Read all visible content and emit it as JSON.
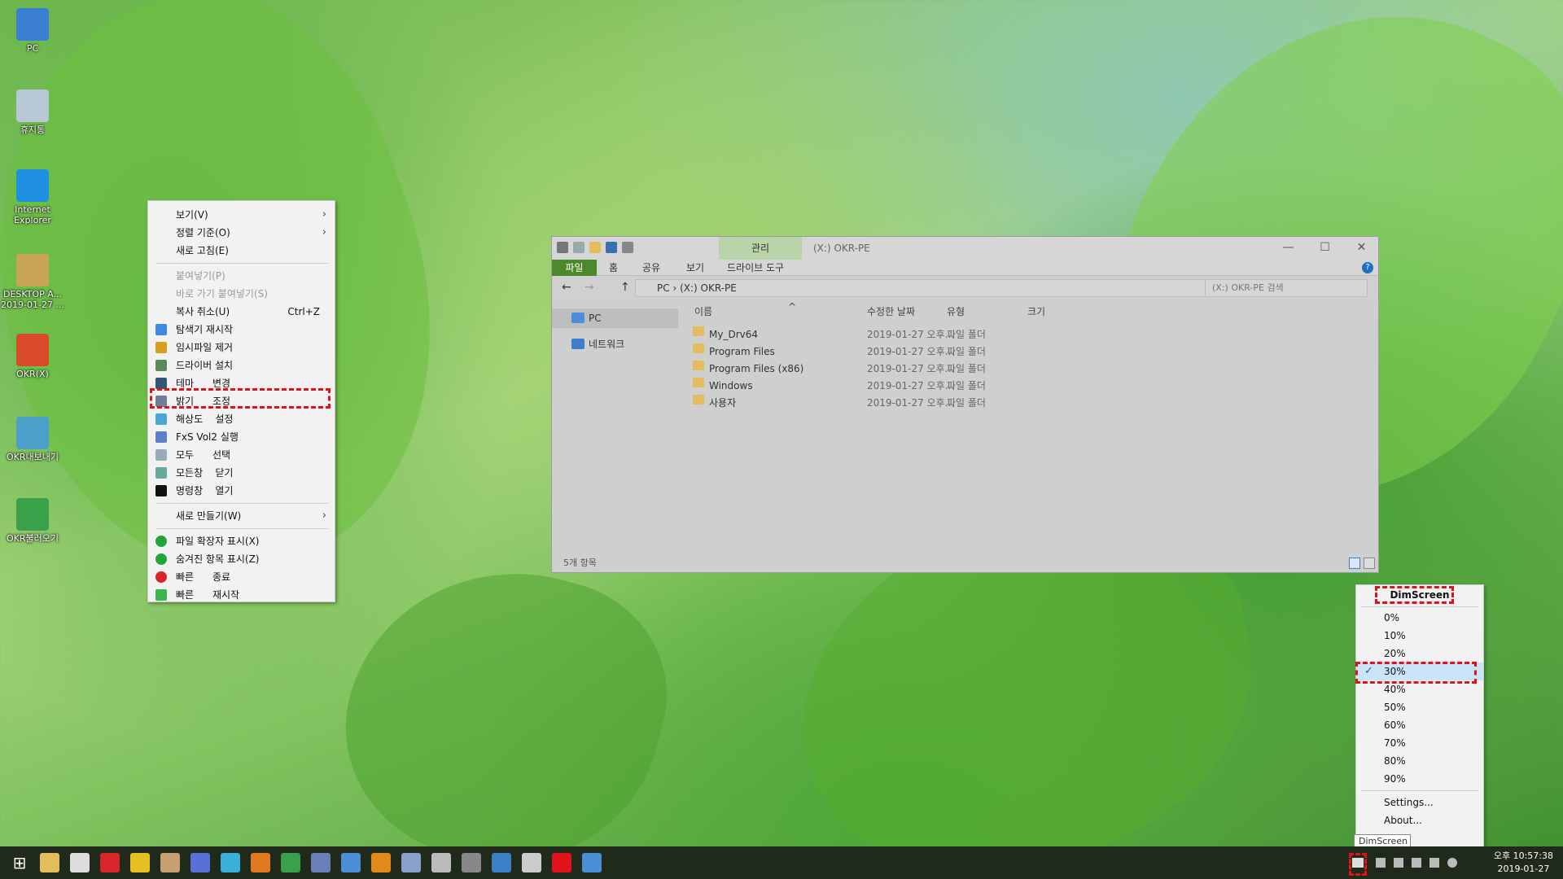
{
  "desktop": {
    "icons": [
      {
        "label": "PC",
        "icon": "pc-icon",
        "color": "#3a7fd0"
      },
      {
        "label": "휴지통",
        "icon": "recycle-bin-icon",
        "color": "#b8c8d6"
      },
      {
        "label": "Internet Explorer",
        "icon": "internet-explorer-icon",
        "color": "#1f8fe0"
      },
      {
        "label": "DESKTOP A... 2019-01-27 ...",
        "icon": "archive-icon",
        "color": "#c9a55a"
      },
      {
        "label": "OKR(X)",
        "icon": "okr-icon",
        "color": "#d84a2a"
      },
      {
        "label": "OKR내보내기",
        "icon": "okr-export-icon",
        "color": "#4aa0c8"
      },
      {
        "label": "OKR불러오기",
        "icon": "okr-import-icon",
        "color": "#3aa04a"
      }
    ]
  },
  "context_menu": {
    "items": [
      {
        "label": "보기(V)",
        "submenu": true
      },
      {
        "label": "정렬 기준(O)",
        "submenu": true
      },
      {
        "label": "새로 고침(E)"
      },
      {
        "label": "붙여넣기(P)",
        "disabled": true
      },
      {
        "label": "바로 가기 붙여넣기(S)",
        "disabled": true
      },
      {
        "label": "복사 취소(U)",
        "shortcut": "Ctrl+Z"
      },
      {
        "label": "탐색기 재시작",
        "icon": "explorer-restart-icon"
      },
      {
        "label": "임시파일 제거",
        "icon": "broom-icon"
      },
      {
        "label": "드라이버 설치",
        "icon": "driver-icon"
      },
      {
        "label": "테마      변경",
        "icon": "theme-icon"
      },
      {
        "label": "밝기      조정",
        "icon": "brightness-icon"
      },
      {
        "label": "해상도    설정",
        "icon": "resolution-icon"
      },
      {
        "label": "FxS Vol2 실행",
        "icon": "fxs-icon"
      },
      {
        "label": "모두      선택",
        "icon": "select-all-icon"
      },
      {
        "label": "모든창    닫기",
        "icon": "close-windows-icon"
      },
      {
        "label": "명령창    열기",
        "icon": "cmd-icon"
      },
      {
        "label": "새로 만들기(W)",
        "submenu": true
      },
      {
        "label": "파일 확장자 표시(X)",
        "icon": "check-green-icon"
      },
      {
        "label": "숨겨진 항목 표시(Z)",
        "icon": "check-green-icon"
      },
      {
        "label": "빠른      종료",
        "icon": "power-icon"
      },
      {
        "label": "빠른      재시작",
        "icon": "restart-icon"
      }
    ]
  },
  "explorer": {
    "context_tab": "관리",
    "title": "(X:) OKR-PE",
    "ribbon_tabs": [
      "파일",
      "홈",
      "공유",
      "보기",
      "드라이브 도구"
    ],
    "path": [
      "PC",
      "(X:) OKR-PE"
    ],
    "search_placeholder": "(X:) OKR-PE 검색",
    "nav": [
      "PC",
      "네트워크"
    ],
    "columns": [
      "이름",
      "수정한 날짜",
      "유형",
      "크기"
    ],
    "rows": [
      {
        "name": "My_Drv64",
        "date": "2019-01-27 오후...",
        "type": "파일 폴더"
      },
      {
        "name": "Program Files",
        "date": "2019-01-27 오후...",
        "type": "파일 폴더"
      },
      {
        "name": "Program Files (x86)",
        "date": "2019-01-27 오후...",
        "type": "파일 폴더"
      },
      {
        "name": "Windows",
        "date": "2019-01-27 오후...",
        "type": "파일 폴더"
      },
      {
        "name": "사용자",
        "date": "2019-01-27 오후...",
        "type": "파일 폴더"
      }
    ],
    "status": "5개 항목"
  },
  "dim_menu": {
    "title": "DimScreen",
    "levels": [
      "0%",
      "10%",
      "20%",
      "30%",
      "40%",
      "50%",
      "60%",
      "70%",
      "80%",
      "90%"
    ],
    "checked": "30%",
    "settings": "Settings...",
    "about": "About..."
  },
  "tooltip": "DimScreen",
  "clock": {
    "time": "오후 10:57:38",
    "date": "2019-01-27"
  }
}
